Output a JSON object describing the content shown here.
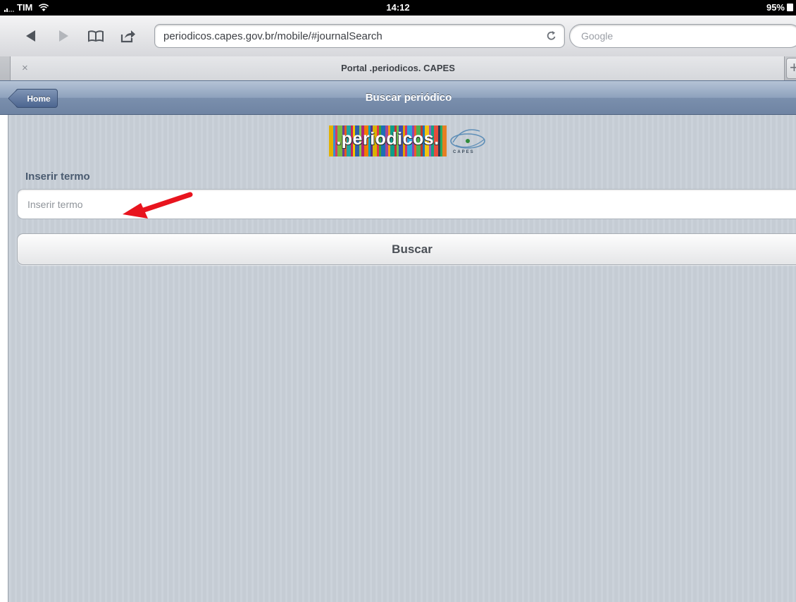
{
  "status_bar": {
    "carrier": "TIM",
    "time": "14:12",
    "battery": "95%"
  },
  "browser": {
    "url": "periodicos.capes.gov.br/mobile/#journalSearch",
    "search_placeholder": "Google",
    "tab_title": "Portal .periodicos. CAPES",
    "tab_close": "×",
    "new_tab": "+"
  },
  "app_header": {
    "home_label": "Home",
    "title": "Buscar periódico"
  },
  "logo": {
    "wordmark": ".periodicos.",
    "org": "CAPES",
    "bar_colors": [
      "#e2b100",
      "#3b8ed0",
      "#d43b6a",
      "#7bb842",
      "#6a3f96",
      "#e45a1e",
      "#1fa6a0",
      "#c8245b",
      "#f2c500",
      "#2f5fa8",
      "#8cc63f",
      "#b4237a",
      "#ef7d00",
      "#00a0c6",
      "#5b2e8a",
      "#d9b300",
      "#e5334b",
      "#3aa23a",
      "#1d6eb5",
      "#a4479b",
      "#f39c12",
      "#0f9d8a",
      "#cc2f2f",
      "#6bbf4e",
      "#3c4db0",
      "#e0a100",
      "#d1306e",
      "#2aa3d9",
      "#8e44ad",
      "#f05a28",
      "#4caf50",
      "#c0392b",
      "#1b75bc",
      "#f1c40f",
      "#9b59b6",
      "#16a085",
      "#e74c3c",
      "#2c3e50",
      "#27ae60",
      "#e67e22"
    ]
  },
  "form": {
    "label": "Inserir termo",
    "input_placeholder": "Inserir termo",
    "input_value": "",
    "submit_label": "Buscar"
  },
  "colors": {
    "annotation_arrow": "#e8141e",
    "header_blue": "#7a8fad"
  }
}
